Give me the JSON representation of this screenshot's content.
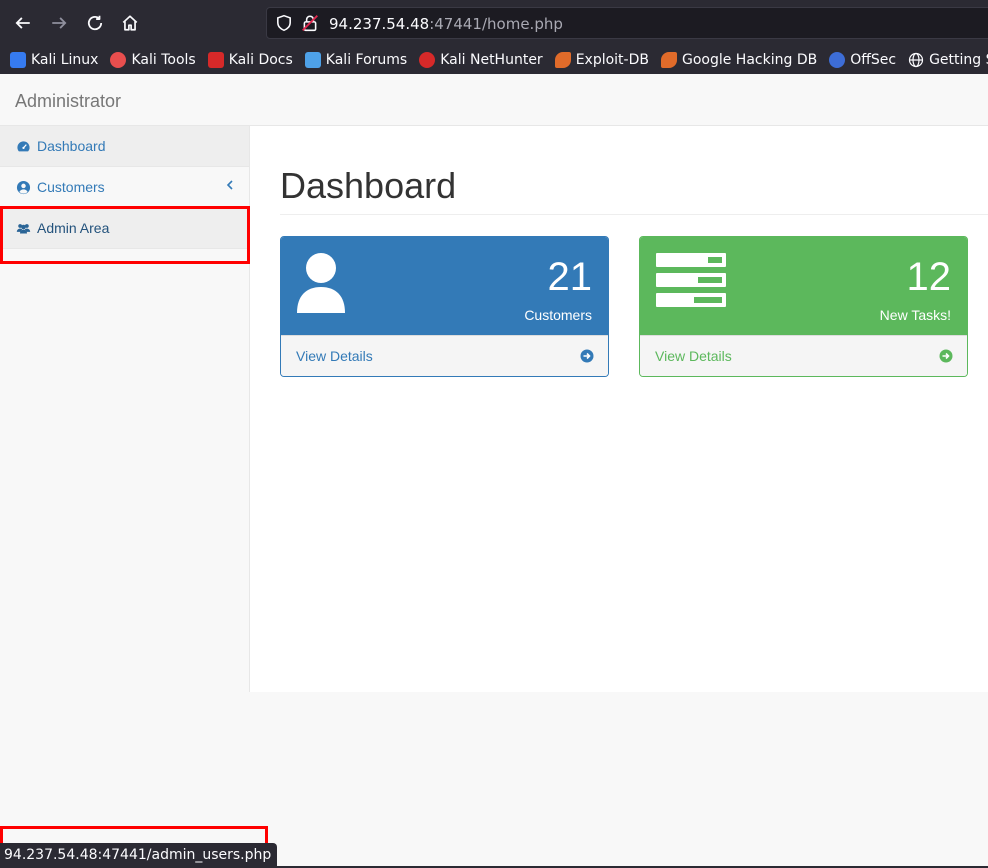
{
  "browser": {
    "url_host": "94.237.54.48",
    "url_rest": ":47441/home.php",
    "bookmarks": [
      {
        "label": "Kali Linux",
        "color": "#367bf0"
      },
      {
        "label": "Kali Tools",
        "color": "#e84e4e"
      },
      {
        "label": "Kali Docs",
        "color": "#d62929"
      },
      {
        "label": "Kali Forums",
        "color": "#4ea1e8"
      },
      {
        "label": "Kali NetHunter",
        "color": "#d62929"
      },
      {
        "label": "Exploit-DB",
        "color": "#e06b2a"
      },
      {
        "label": "Google Hacking DB",
        "color": "#e06b2a"
      },
      {
        "label": "OffSec",
        "color": "#3d6dd6"
      },
      {
        "label": "Getting Started",
        "color": "#cccccc"
      }
    ],
    "status_link": "94.237.54.48:47441/admin_users.php"
  },
  "app": {
    "brand": "Administrator"
  },
  "sidebar": {
    "items": [
      {
        "label": "Dashboard",
        "icon": "dashboard-icon"
      },
      {
        "label": "Customers",
        "icon": "user-circle-icon"
      },
      {
        "label": "Admin Area",
        "icon": "users-icon"
      }
    ]
  },
  "main": {
    "title": "Dashboard",
    "panels": [
      {
        "count": "21",
        "label": "Customers",
        "footer": "View Details",
        "color": "#337ab7"
      },
      {
        "count": "12",
        "label": "New Tasks!",
        "footer": "View Details",
        "color": "#5cb85c"
      }
    ]
  }
}
